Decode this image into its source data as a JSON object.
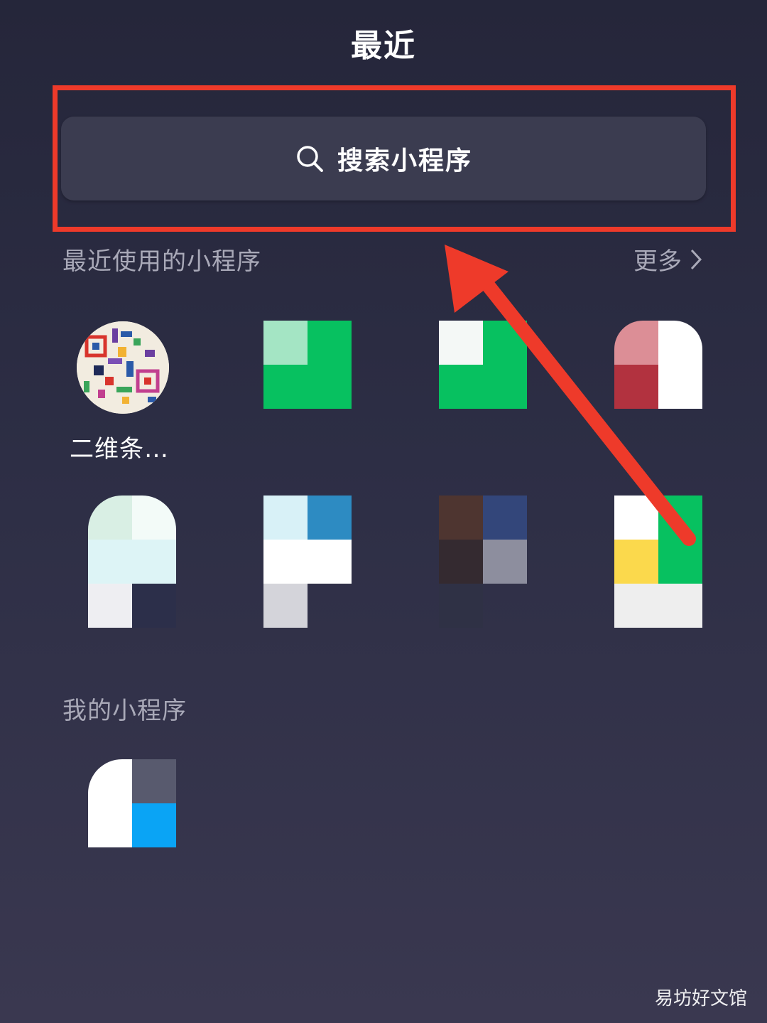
{
  "header": {
    "title": "最近"
  },
  "search": {
    "label": "搜索小程序",
    "icon": "search-icon"
  },
  "recent": {
    "header": "最近使用的小程序",
    "more_label": "更多",
    "first_app_name": "二维条…"
  },
  "mine": {
    "header": "我的小程序"
  },
  "watermark": "易坊好文馆",
  "colors": {
    "highlight": "#ee3a2a",
    "background": "#2a2b40",
    "search_bar": "#3b3c50",
    "section_text": "#a9a9b8",
    "wechat_green": "#07c160"
  }
}
